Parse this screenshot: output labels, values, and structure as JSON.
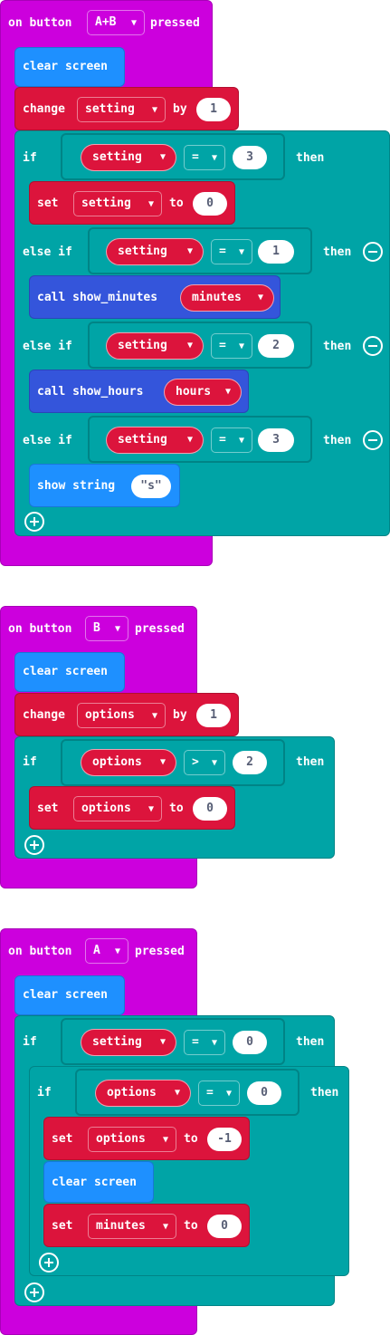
{
  "colors": {
    "event": "#cc00dd",
    "basic_show": "#1e90ff",
    "variables": "#dc143c",
    "logic": "#00a4a6",
    "functions": "#3455db"
  },
  "blocks": [
    {
      "event": {
        "prefix": "on button",
        "button": "A+B",
        "suffix": "pressed"
      },
      "clear_screen": "clear screen",
      "change": {
        "kw": "change",
        "var": "setting",
        "by": "by",
        "value": "1"
      },
      "if": {
        "kw": "if",
        "left": "setting",
        "op": "=",
        "right": "3",
        "then": "then",
        "set": {
          "kw": "set",
          "var": "setting",
          "to": "to",
          "value": "0"
        }
      },
      "elseifs": [
        {
          "kw": "else if",
          "left": "setting",
          "op": "=",
          "right": "1",
          "then": "then",
          "call": {
            "kw": "call show_minutes",
            "arg": "minutes"
          }
        },
        {
          "kw": "else if",
          "left": "setting",
          "op": "=",
          "right": "2",
          "then": "then",
          "call": {
            "kw": "call show_hours",
            "arg": "hours"
          }
        },
        {
          "kw": "else if",
          "left": "setting",
          "op": "=",
          "right": "3",
          "then": "then",
          "show": {
            "kw": "show string",
            "value": "s"
          }
        }
      ]
    },
    {
      "event": {
        "prefix": "on button",
        "button": "B",
        "suffix": "pressed"
      },
      "clear_screen": "clear screen",
      "change": {
        "kw": "change",
        "var": "options",
        "by": "by",
        "value": "1"
      },
      "if": {
        "kw": "if",
        "left": "options",
        "op": ">",
        "right": "2",
        "then": "then",
        "set": {
          "kw": "set",
          "var": "options",
          "to": "to",
          "value": "0"
        }
      }
    },
    {
      "event": {
        "prefix": "on button",
        "button": "A",
        "suffix": "pressed"
      },
      "clear_screen": "clear screen",
      "if": {
        "kw": "if",
        "left": "setting",
        "op": "=",
        "right": "0",
        "then": "then",
        "inner_if": {
          "kw": "if",
          "left": "options",
          "op": "=",
          "right": "0",
          "then": "then",
          "set1": {
            "kw": "set",
            "var": "options",
            "to": "to",
            "value": "-1"
          },
          "clear_screen": "clear screen",
          "set2": {
            "kw": "set",
            "var": "minutes",
            "to": "to",
            "value": "0"
          }
        }
      }
    }
  ]
}
